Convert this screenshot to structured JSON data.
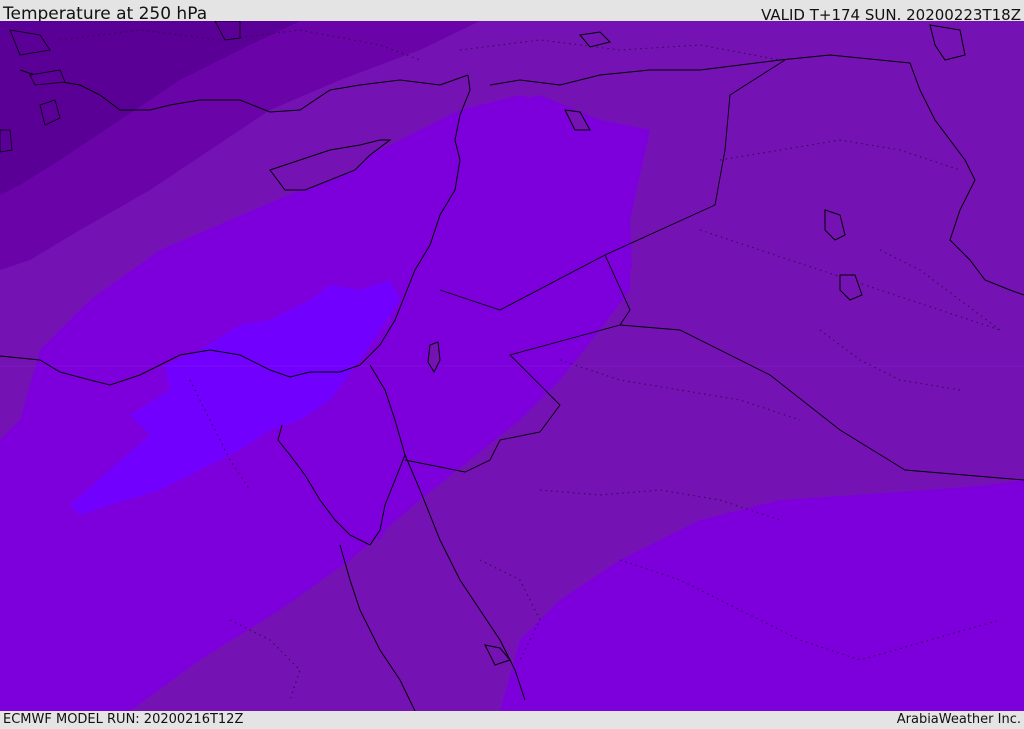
{
  "header": {
    "title": "Temperature at 250 hPa",
    "valid": "VALID T+174 SUN. 20200223T18Z"
  },
  "footer": {
    "model_run": "ECMWF MODEL RUN: 20200216T12Z",
    "credit": "ArabiaWeather Inc."
  },
  "map": {
    "field": "Temperature at 250 hPa",
    "colors": {
      "coldest": "#5a0096",
      "cold": "#6a04a8",
      "mid": "#7512b4",
      "warm": "#7d00dc",
      "warmer": "#8400f0",
      "warmest": "#7200ff",
      "coastline": "#000000",
      "boundary_dotted": "#2a0a40"
    }
  }
}
